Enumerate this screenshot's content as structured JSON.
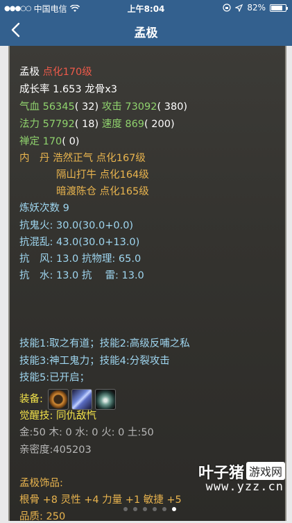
{
  "status": {
    "carrier": "中国电信",
    "time": "上午8:04",
    "battery": "82%",
    "battery_level": 0.82
  },
  "nav": {
    "title": "孟极"
  },
  "stats": {
    "name": "孟极",
    "refine_level": "点化170级",
    "growth": "成长率 1.653 龙骨x3",
    "qixue_label": "气血 56345",
    "qixue_extra": "( 32)",
    "attack_label": "攻击 73092",
    "attack_extra": "( 380)",
    "mana_label": "法力 57792",
    "mana_extra": "( 18)",
    "speed_label": "速度 869",
    "speed_extra": "( 200)",
    "zen_label": "禅定 170",
    "zen_extra": "( 0)",
    "neidan_label": "内　丹",
    "neidan_1": "浩然正气 点化167级",
    "neidan_2": "隔山打牛 点化164级",
    "neidan_3": "暗渡陈仓 点化165级",
    "refine_count": "炼妖次数 9",
    "resist_ghost_fire": "抗鬼火: 30.0(30.0+0.0)",
    "resist_chaos": "抗混乱: 43.0(30.0+13.0)",
    "resist_wind_phys": "抗　风: 13.0 抗物理: 65.0",
    "resist_water_thunder": "抗　水: 13.0 抗　 雷: 13.0"
  },
  "skills": {
    "line1": "技能1:取之有道；技能2:高级反哺之私",
    "line2": "技能3:神工鬼力；技能4:分裂攻击",
    "line3": "技能5:已开启；",
    "equip_label": "装备:",
    "awaken": "觉醒技:  同仇敌忾",
    "elements": "金:50 木: 0 水: 0 火: 0 土:50",
    "intimacy": "亲密度:405203"
  },
  "ornament": {
    "title": "孟极饰品:",
    "attrs": "根骨 +8 灵性 +4 力量 +1 敏捷 +5",
    "quality": "品质: 250"
  },
  "watermark": {
    "brand": "叶子猪",
    "box": "游戏网",
    "url": "www.yzz.cn"
  },
  "colors": {
    "nav_bg": "#33608e",
    "panel_bg": "#34332f",
    "red": "#ee5a4a",
    "green": "#8fd26d",
    "orange": "#e9b44e",
    "blue": "#9fd6f0",
    "yellow": "#f2e24a"
  },
  "icons": {
    "back": "chevron-left-icon",
    "wifi": "wifi-icon",
    "location": "location-arrow-icon",
    "lock": "rotation-lock-icon",
    "battery": "battery-icon"
  },
  "pager": {
    "total": 6,
    "active_index": 5
  }
}
